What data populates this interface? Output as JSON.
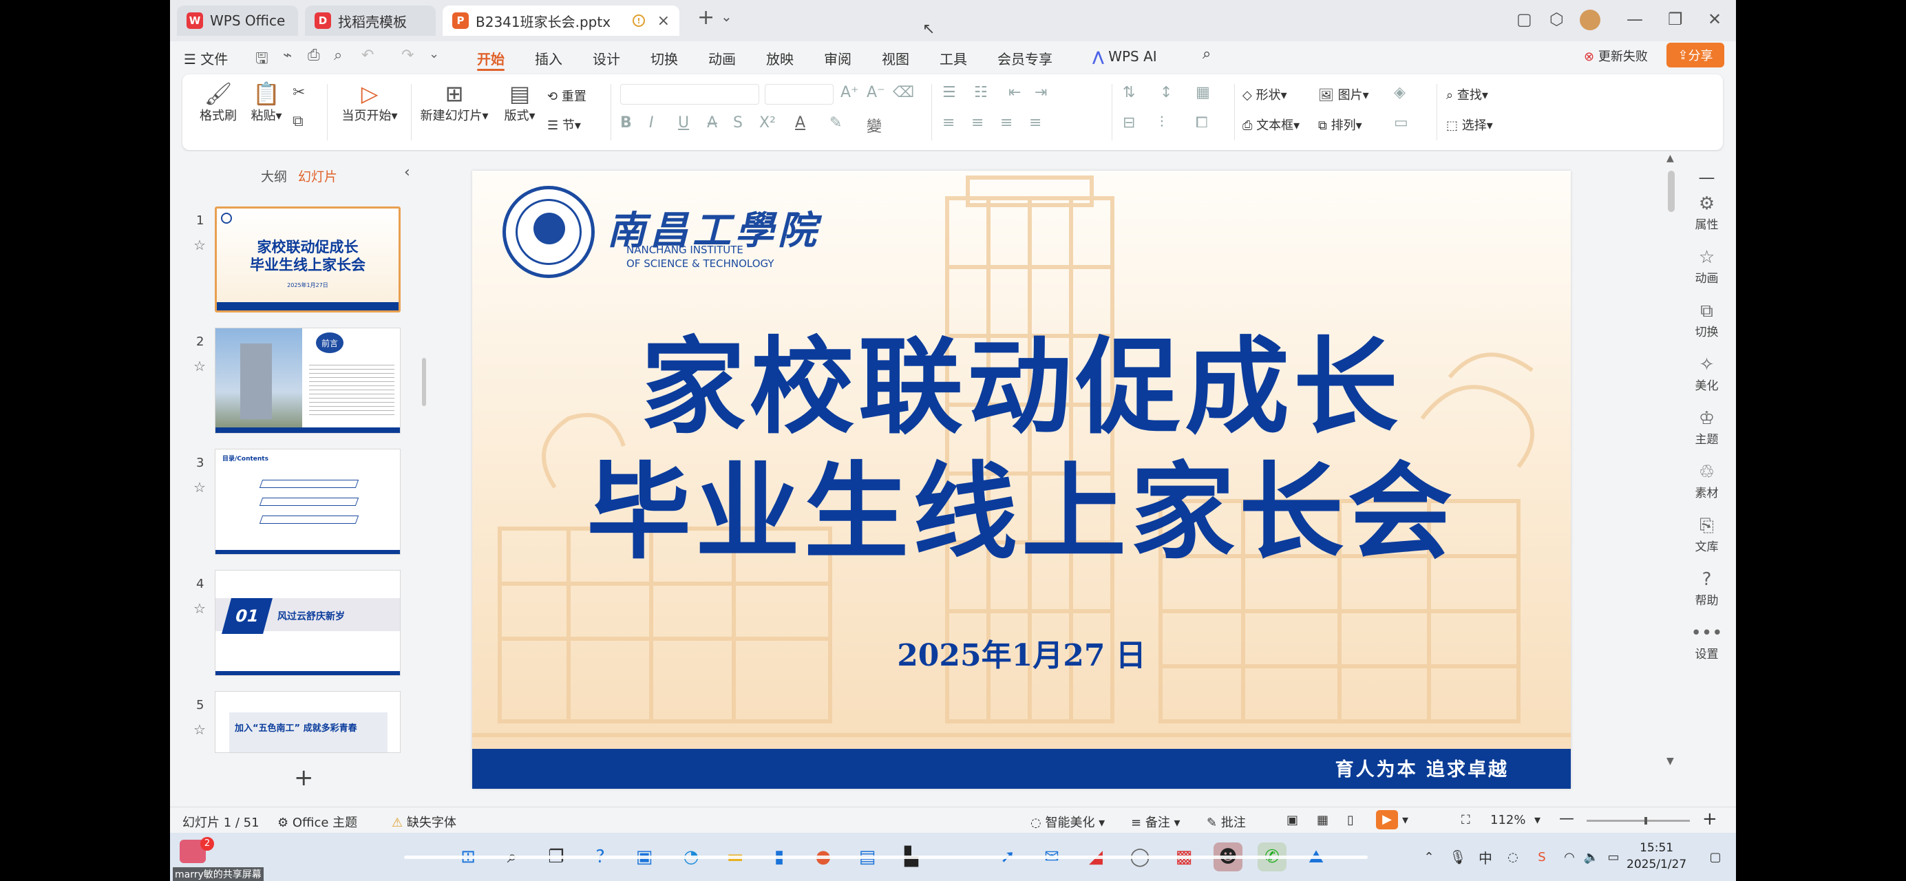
{
  "titlebar": {
    "tabs": [
      {
        "label": "WPS Office",
        "icon": "wps-logo-icon"
      },
      {
        "label": "找稻壳模板",
        "icon": "docer-icon"
      },
      {
        "label": "B2341班家长会.pptx",
        "icon": "pptx-icon"
      }
    ],
    "new_tab": "+",
    "new_tab_arrow": "⌄"
  },
  "menubar": {
    "file": "文件",
    "tabs": [
      "开始",
      "插入",
      "设计",
      "切换",
      "动画",
      "放映",
      "审阅",
      "视图",
      "工具",
      "会员专享"
    ],
    "active_tab": "开始",
    "wps_ai": "WPS AI",
    "update_status": "更新失败",
    "share": "分享"
  },
  "ribbon": {
    "format_painter": "格式刷",
    "paste": "粘贴",
    "play_from_current": "当页开始",
    "new_slide": "新建幻灯片",
    "layout": "版式",
    "reset": "重置",
    "section": "节",
    "shape": "形状",
    "picture": "图片",
    "textbox": "文本框",
    "arrange": "排列",
    "find": "查找",
    "select": "选择"
  },
  "leftpane": {
    "outline_tab": "大纲",
    "slides_tab": "幻灯片",
    "thumbnails": [
      {
        "num": "1",
        "title": "家校联动促成长",
        "subtitle": "毕业生线上家长会",
        "date": "2025年1月27日"
      },
      {
        "num": "2",
        "badge": "前言"
      },
      {
        "num": "3",
        "heading": "目录/Contents"
      },
      {
        "num": "4",
        "num_tag": "01",
        "text": "风过云舒庆新岁"
      },
      {
        "num": "5",
        "text": "加入“五色南工” 成就多彩青春"
      }
    ]
  },
  "slide": {
    "school_name": "南昌工學院",
    "school_name_en_1": "NANCHANG INSTITUTE",
    "school_name_en_2": "OF SCIENCE & TECHNOLOGY",
    "title_line1": "家校联动促成长",
    "title_line2": "毕业生线上家长会",
    "date": "2025年1月27 日",
    "motto": "育人为本 追求卓越",
    "title_color": "#0b3c9c",
    "band_color": "#0a3c96"
  },
  "rightpanel": {
    "items": [
      "属性",
      "动画",
      "切换",
      "美化",
      "主题",
      "素材",
      "文库",
      "帮助",
      "设置"
    ]
  },
  "statusbar": {
    "slide_count": "幻灯片 1 / 51",
    "theme": "Office 主题",
    "missing_font": "缺失字体",
    "smart_beautify": "智能美化",
    "notes": "备注",
    "comments": "批注",
    "zoom": "112%"
  },
  "taskbar": {
    "time": "15:51",
    "date": "2025/1/27",
    "ime": "中",
    "share_label": "marry敏的共享屏幕",
    "notif_badge": "2"
  }
}
